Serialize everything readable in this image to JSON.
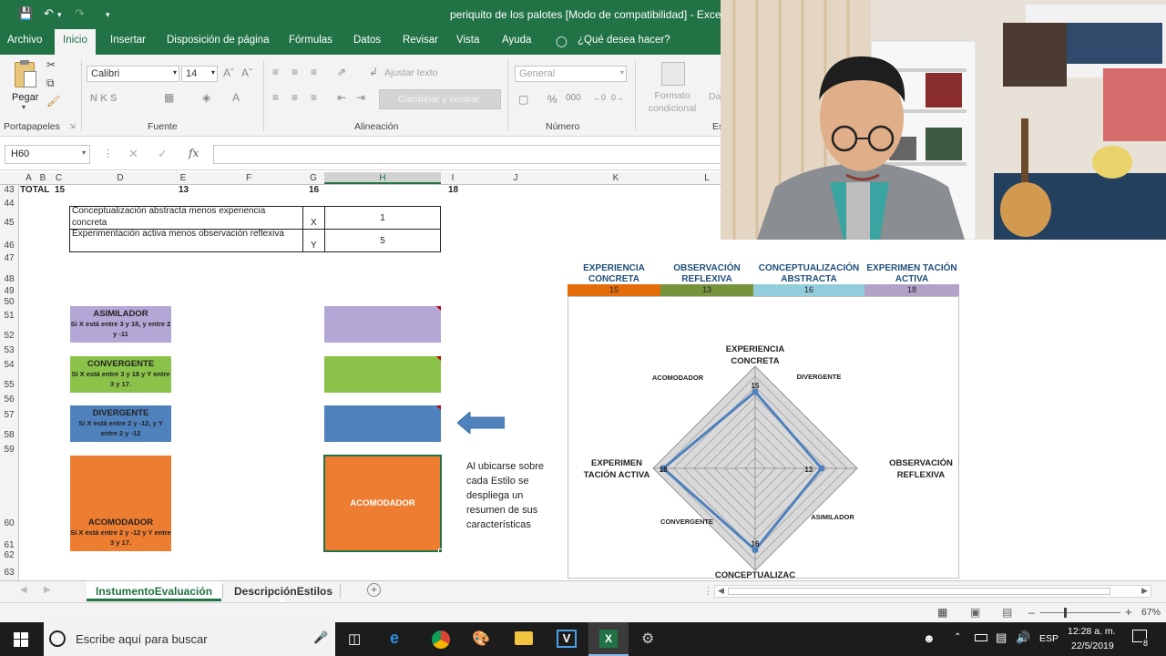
{
  "window": {
    "title": "periquito de los palotes  [Modo de compatibilidad]  -  Excel"
  },
  "ribbon_tabs": [
    "Archivo",
    "Inicio",
    "Insertar",
    "Disposición de página",
    "Fórmulas",
    "Datos",
    "Revisar",
    "Vista",
    "Ayuda",
    "¿Qué desea hacer?"
  ],
  "ribbon": {
    "paste_label": "Pegar",
    "clipboard_group": "Portapapeles",
    "font_name": "Calibri",
    "font_size": "14",
    "font_group": "Fuente",
    "bold_italic_underline": "N  K  S",
    "wrap_text": "Ajustar texto",
    "merge_center": "Combinar y centrar",
    "alignment_group": "Alineación",
    "number_format": "General",
    "number_group": "Número",
    "conditional_format": "Formato condicional",
    "cut_off_text": "Da",
    "cut_off_group": "Es"
  },
  "formula_bar": {
    "name_box": "H60",
    "fx": "fx"
  },
  "columns": [
    {
      "label": "A"
    },
    {
      "label": "B"
    },
    {
      "label": "C"
    },
    {
      "label": "D"
    },
    {
      "label": "E"
    },
    {
      "label": "F"
    },
    {
      "label": "G"
    },
    {
      "label": "H"
    },
    {
      "label": "I"
    },
    {
      "label": "J"
    },
    {
      "label": "K"
    },
    {
      "label": "L"
    }
  ],
  "rows": [
    "43",
    "44",
    "45",
    "46",
    "47",
    "48",
    "49",
    "50",
    "51",
    "52",
    "53",
    "54",
    "55",
    "56",
    "57",
    "58",
    "59",
    "60",
    "61",
    "62",
    "63"
  ],
  "total_row": {
    "label": "TOTAL",
    "c": "15",
    "e": "13",
    "g": "16",
    "i": "18"
  },
  "xy_table": [
    {
      "desc": "Conceptualización abstracta menos experiencia concreta",
      "var": "X",
      "value": "1"
    },
    {
      "desc": "Experimentación activa menos observación reflexiva",
      "var": "Y",
      "value": "5"
    }
  ],
  "styles": [
    {
      "name": "ASIMILADOR",
      "rule": "Si X está entre 3 y 18, y entre 2 y -11",
      "color": "#b4a7d6"
    },
    {
      "name": "CONVERGENTE",
      "rule": "Si X está entre 3 y 18 y Y entre 3 y 17.",
      "color": "#8bc34a"
    },
    {
      "name": "DIVERGENTE",
      "rule": "Si X está entre 2 y -12, y Y entre 2 y -12",
      "color": "#4f81bd"
    },
    {
      "name": "ACOMODADOR",
      "rule": "Si X está entre 2 y -12 y Y entre 3 y 17.",
      "color": "#ed7d31"
    }
  ],
  "result_box": {
    "label": "ACOMODADOR"
  },
  "note": "Al ubicarse sobre cada Estilo se despliega un resumen de sus características",
  "chart_header": [
    {
      "label": "EXPERIENCIA CONCRETA",
      "value": "15",
      "color": "#e46c0a"
    },
    {
      "label": "OBSERVACIÓN REFLEXIVA",
      "value": "13",
      "color": "#77933c"
    },
    {
      "label": "CONCEPTUALIZACIÓN ABSTRACTA",
      "value": "16",
      "color": "#92cddc"
    },
    {
      "label": "EXPERIMEN TACIÓN ACTIVA",
      "value": "18",
      "color": "#b3a2c7"
    }
  ],
  "chart_data": {
    "type": "radar",
    "axes": [
      "EXPERIENCIA CONCRETA",
      "OBSERVACIÓN REFLEXIVA",
      "CONCEPTUALIZAC",
      "EXPERIMEN TACIÓN ACTIVA"
    ],
    "values": [
      15,
      13,
      16,
      18
    ],
    "rmax": 20,
    "grid_levels": 10,
    "quadrant_labels": [
      "ACOMODADOR",
      "DIVERGENTE",
      "ASIMILADOR",
      "CONVERGENTE"
    ],
    "series_color": "#4f81bd"
  },
  "sheet_tabs": [
    "InstumentoEvaluación",
    "DescripciónEstilos"
  ],
  "status": {
    "zoom": "67%"
  },
  "taskbar": {
    "search_placeholder": "Escribe aquí para buscar",
    "lang": "ESP",
    "time": "12:28 a. m.",
    "date": "22/5/2019",
    "notifications": "8"
  }
}
